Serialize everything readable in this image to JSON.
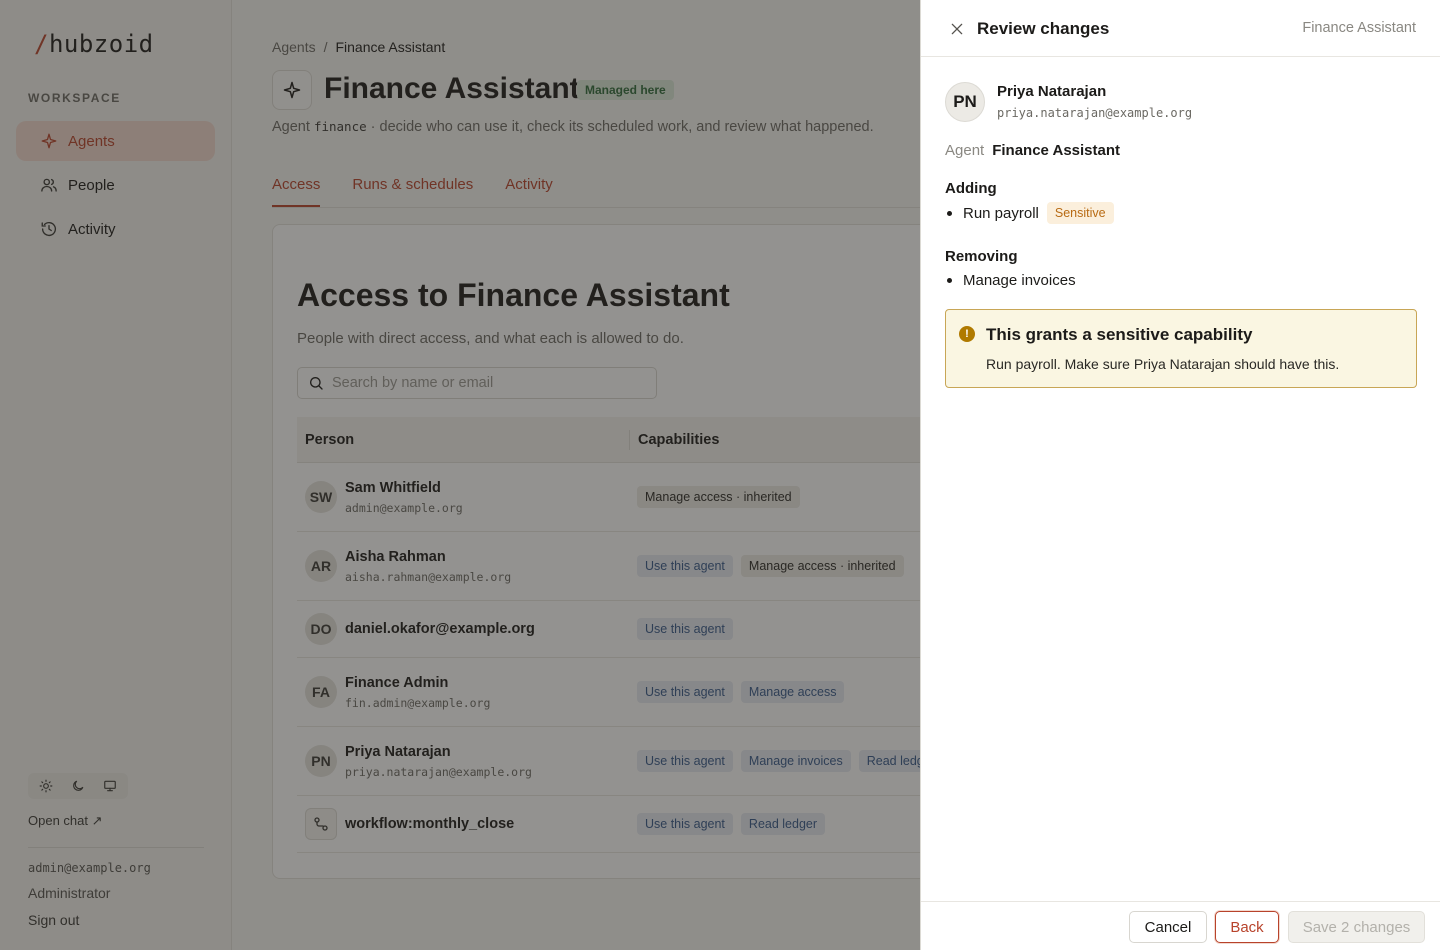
{
  "app": {
    "logo_slash": "/",
    "logo_text": "hubzoid",
    "brand_color": "#b8432b"
  },
  "sidebar": {
    "workspace_label": "WORKSPACE",
    "items": [
      {
        "label": "Agents",
        "icon": "sparkle-icon",
        "active": true
      },
      {
        "label": "People",
        "icon": "people-icon",
        "active": false
      },
      {
        "label": "Activity",
        "icon": "history-icon",
        "active": false
      }
    ],
    "theme_options": [
      "sun-icon",
      "moon-icon",
      "monitor-icon"
    ],
    "open_chat": "Open chat ↗",
    "user_email": "admin@example.org",
    "user_role": "Administrator",
    "sign_out": "Sign out"
  },
  "header": {
    "breadcrumb": [
      "Agents",
      "Finance Assistant"
    ],
    "breadcrumb_sep": "/",
    "title": "Finance Assistant",
    "badge": "Managed here",
    "subtitle_prefix": "Agent",
    "subtitle_code": "finance",
    "subtitle_suffix": "· decide who can use it, check its scheduled work, and review what happened.",
    "tabs": [
      {
        "label": "Access",
        "active": true
      },
      {
        "label": "Runs & schedules",
        "active": false
      },
      {
        "label": "Activity",
        "active": false
      }
    ]
  },
  "access": {
    "title": "Access to Finance Assistant",
    "subtitle": "People with direct access, and what each is allowed to do.",
    "search_placeholder": "Search by name or email",
    "columns": [
      "Person",
      "Capabilities"
    ],
    "rows": [
      {
        "initials": "SW",
        "name": "Sam Whitfield",
        "email": "admin@example.org",
        "caps": [
          {
            "label": "Manage access · inherited",
            "kind": "gray"
          }
        ]
      },
      {
        "initials": "AR",
        "name": "Aisha Rahman",
        "email": "aisha.rahman@example.org",
        "caps": [
          {
            "label": "Use this agent",
            "kind": "blue"
          },
          {
            "label": "Manage access · inherited",
            "kind": "gray"
          }
        ]
      },
      {
        "initials": "DO",
        "name": "daniel.okafor@example.org",
        "email": "",
        "caps": [
          {
            "label": "Use this agent",
            "kind": "blue"
          }
        ]
      },
      {
        "initials": "FA",
        "name": "Finance Admin",
        "email": "fin.admin@example.org",
        "caps": [
          {
            "label": "Use this agent",
            "kind": "blue"
          },
          {
            "label": "Manage access",
            "kind": "blue"
          }
        ]
      },
      {
        "initials": "PN",
        "name": "Priya Natarajan",
        "email": "priya.natarajan@example.org",
        "caps": [
          {
            "label": "Use this agent",
            "kind": "blue"
          },
          {
            "label": "Manage invoices",
            "kind": "blue"
          },
          {
            "label": "Read ledger",
            "kind": "blue"
          }
        ]
      },
      {
        "initials": "",
        "name": "workflow:monthly_close",
        "email": "",
        "icon": "workflow-icon",
        "caps": [
          {
            "label": "Use this agent",
            "kind": "blue"
          },
          {
            "label": "Read ledger",
            "kind": "blue"
          }
        ]
      }
    ]
  },
  "drawer": {
    "title": "Review changes",
    "context": "Finance Assistant",
    "person_initials": "PN",
    "person_name": "Priya Natarajan",
    "person_email": "priya.natarajan@example.org",
    "agent_key": "Agent",
    "agent_value": "Finance Assistant",
    "adding_label": "Adding",
    "adding_item": "Run payroll",
    "adding_badge": "Sensitive",
    "removing_label": "Removing",
    "removing_item": "Manage invoices",
    "warning_icon": "!",
    "warning_title": "This grants a sensitive capability",
    "warning_body": "Run payroll. Make sure Priya Natarajan should have this.",
    "cancel": "Cancel",
    "back": "Back",
    "save": "Save 2 changes"
  }
}
